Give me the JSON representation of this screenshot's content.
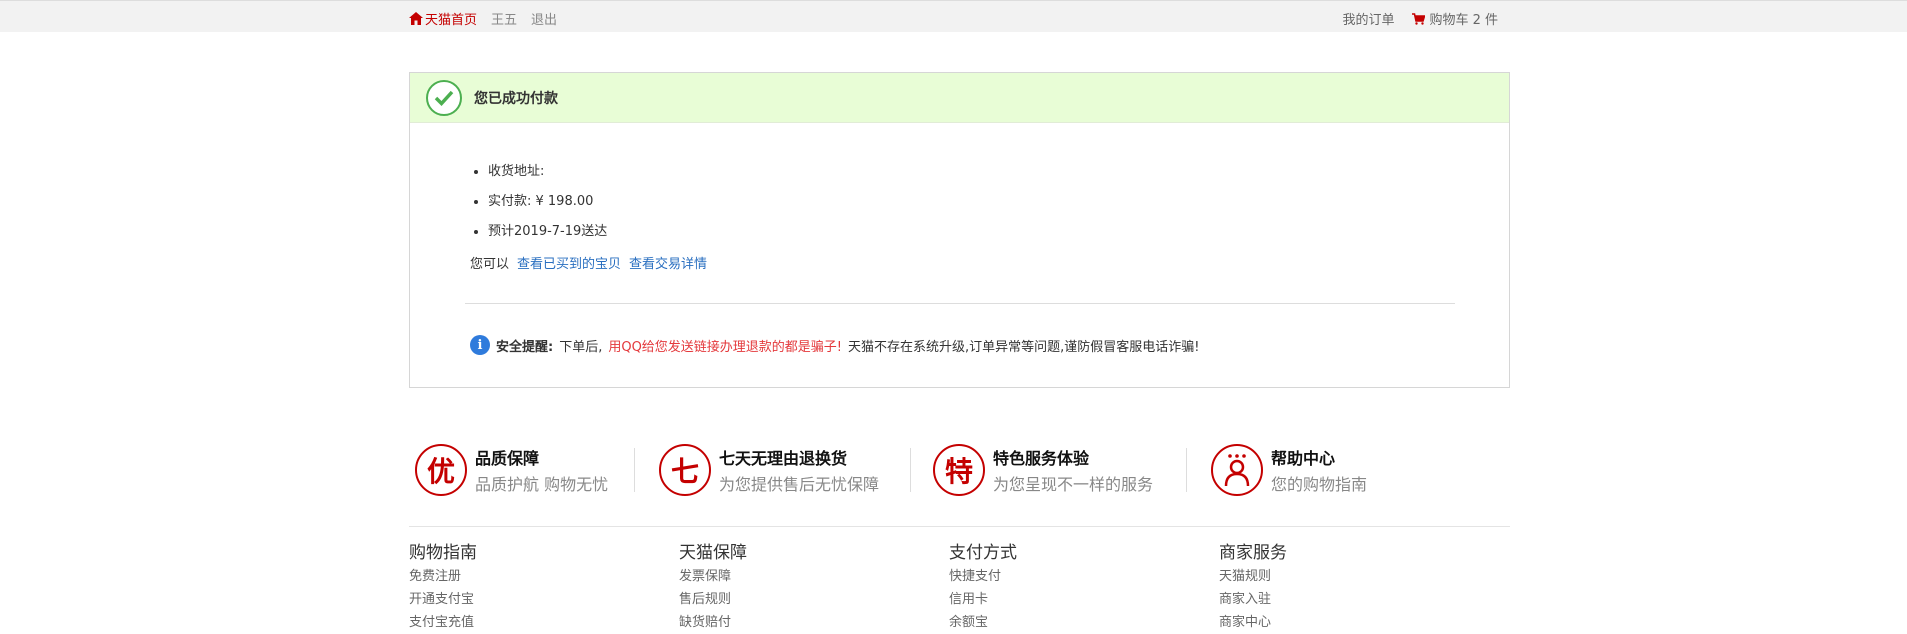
{
  "topbar": {
    "home": "天猫首页",
    "user": "王五",
    "logout": "退出",
    "orders": "我的订单",
    "cart": "购物车 2 件"
  },
  "success": {
    "title": "您已成功付款",
    "items": [
      "收货地址:",
      "实付款:  ¥ 198.00",
      "预计2019-7-19送达"
    ],
    "view_prefix": "您可以",
    "link_bought": "查看已买到的宝贝",
    "link_detail": "查看交易详情"
  },
  "notice": {
    "label": "安全提醒:",
    "text1": "下单后,",
    "red": "用QQ给您发送链接办理退款的都是骗子!",
    "text2": "天猫不存在系统升级,订单异常等问题,谨防假冒客服电话诈骗!"
  },
  "services": [
    {
      "icon": "优",
      "title": "品质保障",
      "desc": "品质护航 购物无忧"
    },
    {
      "icon": "七",
      "title": "七天无理由退换货",
      "desc": "为您提供售后无忧保障"
    },
    {
      "icon": "特",
      "title": "特色服务体验",
      "desc": "为您呈现不一样的服务"
    },
    {
      "icon": "help",
      "title": "帮助中心",
      "desc": "您的购物指南"
    }
  ],
  "footer": [
    {
      "title": "购物指南",
      "links": [
        "免费注册",
        "开通支付宝",
        "支付宝充值"
      ]
    },
    {
      "title": "天猫保障",
      "links": [
        "发票保障",
        "售后规则",
        "缺货赔付"
      ]
    },
    {
      "title": "支付方式",
      "links": [
        "快捷支付",
        "信用卡",
        "余额宝"
      ]
    },
    {
      "title": "商家服务",
      "links": [
        "天猫规则",
        "商家入驻",
        "商家中心"
      ]
    }
  ],
  "colors": {
    "accent": "#c40000",
    "success_bg": "#e8fdd6",
    "link": "#2a6fc0"
  }
}
